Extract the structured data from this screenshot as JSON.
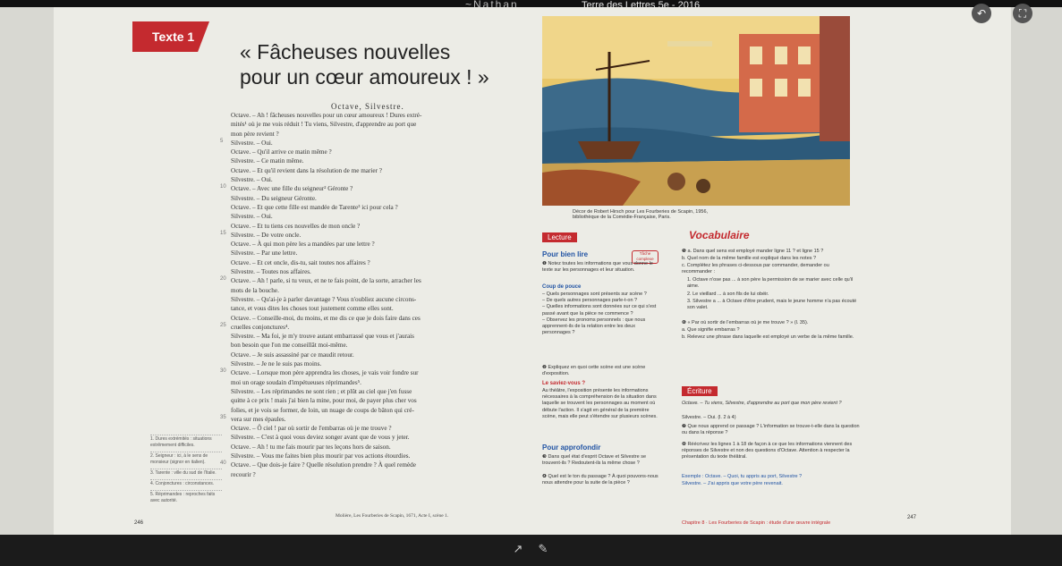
{
  "app": {
    "title": "Terre des Lettres 5e - 2016",
    "logo": "~Nathan"
  },
  "toolbar": {
    "undo_icon": "undo-icon",
    "fullscreen_icon": "fullscreen-icon"
  },
  "page": {
    "tab_label": "Texte 1",
    "heading_line1": "« Fâcheuses nouvelles",
    "heading_line2": "pour un cœur amoureux ! »",
    "speakers": "Octave, Silvestre.",
    "dialogue": [
      "Octave. – Ah ! fâcheuses nouvelles pour un cœur amoureux ! Dures extré-",
      "mités¹ où je me vois réduit ! Tu viens, Silvestre, d'apprendre au port que",
      "mon père revient ?",
      "Silvestre. – Oui.",
      "Octave. – Qu'il arrive ce matin même ?",
      "Silvestre. – Ce matin même.",
      "Octave. – Et qu'il revient dans la résolution de me marier ?",
      "Silvestre. – Oui.",
      "Octave. – Avec une fille du seigneur² Géronte ?",
      "Silvestre. – Du seigneur Géronte.",
      "Octave. – Et que cette fille est mandée de Tarente³ ici pour cela ?",
      "Silvestre. – Oui.",
      "Octave. – Et tu tiens ces nouvelles de mon oncle ?",
      "Silvestre. – De votre oncle.",
      "Octave. – À qui mon père les a mandées par une lettre ?",
      "Silvestre. – Par une lettre.",
      "Octave. – Et cet oncle, dis-tu, sait toutes nos affaires ?",
      "Silvestre. – Toutes nos affaires.",
      "Octave. – Ah ! parle, si tu veux, et ne te fais point, de la sorte, arracher les",
      "mots de la bouche.",
      "Silvestre. – Qu'ai-je à parler davantage ? Vous n'oubliez aucune circons-",
      "tance, et vous dites les choses tout justement comme elles sont.",
      "Octave. – Conseille-moi, du moins, et me dis ce que je dois faire dans ces",
      "cruelles conjonctures⁴.",
      "Silvestre. – Ma foi, je m'y trouve autant embarrassé que vous et j'aurais",
      "bon besoin que l'on me conseillât moi-même.",
      "Octave. – Je suis assassiné par ce maudit retour.",
      "Silvestre. – Je ne le suis pas moins.",
      "Octave. – Lorsque mon père apprendra les choses, je vais voir fondre sur",
      "moi un orage soudain d'impétueuses réprimandes⁵.",
      "Silvestre. – Les réprimandes ne sont rien ; et plût au ciel que j'en fusse",
      "quitte à ce prix ! mais j'ai bien la mine, pour moi, de payer plus cher vos",
      "folies, et je vois se former, de loin, un nuage de coups de bâton qui cré-",
      "vera sur mes épaules.",
      "Octave. – Ô ciel ! par où sortir de l'embarras où je me trouve ?",
      "Silvestre. – C'est à quoi vous deviez songer avant que de vous y jeter.",
      "Octave. – Ah ! tu me fais mourir par tes leçons hors de saison.",
      "Silvestre. – Vous me faites bien plus mourir par vos actions étourdies.",
      "Octave. – Que dois-je faire ? Quelle résolution prendre ? À quel remède",
      "recourir ?"
    ],
    "line_numbers": [
      "5",
      "10",
      "15",
      "20",
      "25",
      "30",
      "35",
      "40"
    ],
    "notes": [
      "1. Dures extrémités : situations extrêmement difficiles.",
      "2. Seigneur : ici, à le sens de monsieur (signor en italien).",
      "3. Tarente : ville du sud de l'Italie.",
      "4. Conjonctures : circonstances.",
      "5. Réprimandes : reproches faits avec autorité."
    ],
    "credit": "Molière, Les Fourberies de Scapin, 1671, Acte I, scène 1.",
    "page_left": "246",
    "page_right": "247",
    "caption_line1": "Décor de Robert Hirsch pour Les Fourberies de Scapin, 1956,",
    "caption_line2": "bibliothèque de la Comédie-Française, Paris."
  },
  "lecture": {
    "badge": "Lecture",
    "pour_bien_lire": "Pour bien lire",
    "tache": "Tâche complexe",
    "q1": "❶ Notez toutes les informations que vous donne le texte sur les personnages et leur situation.",
    "coup_de_pouce": "Coup de pouce",
    "coup_items": [
      "– Quels personnages sont présents sur scène ?",
      "– De quels autres personnages parle-t-on ?",
      "– Quelles informations sont données sur ce qui s'est passé avant que la pièce ne commence ?",
      "– Observez les pronoms personnels : que nous apprennent-ils de la relation entre les deux personnages ?"
    ],
    "q2": "❷ Expliquez en quoi cette scène est une scène d'exposition.",
    "le_saviez": "Le saviez-vous ?",
    "saviez_text": "Au théâtre, l'exposition présente les informations nécessaires à la compréhension de la situation dans laquelle se trouvent les personnages au moment où débute l'action. Il s'agit en général de la première scène, mais elle peut s'étendre sur plusieurs scènes.",
    "approfondir": "Pour approfondir",
    "q3": "❸ Dans quel état d'esprit Octave et Silvestre se trouvent-ils ? Redoutent-ils la même chose ?",
    "q4": "❹ Quel est le ton du passage ? À quoi pouvons-nous nous attendre pour la suite de la pièce ?"
  },
  "vocabulaire": {
    "title": "Vocabulaire",
    "q5": "❺ a. Dans quel sens est employé mander ligne 11 ? et ligne 15 ?",
    "q5b": "b. Quel nom de la même famille est expliqué dans les notes ?",
    "q5c": "c. Complétez les phrases ci-dessous par commander, demander ou recommander :",
    "q5c1": "1. Octave n'ose pas ... à son père la permission de se marier avec celle qu'il aime.",
    "q5c2": "2. Le vieillard ... à son fils de lui obéir.",
    "q5c3": "3. Silvestre a ... à Octave d'être prudent, mais le jeune homme n'a pas écouté son valet.",
    "q6": "❻ « Par où sortir de l'embarras où je me trouve ? » (l. 35).",
    "q6a": "a. Que signifie embarras ?",
    "q6b": "b. Relevez une phrase dans laquelle est employé un verbe de la même famille.",
    "ecriture_badge": "Écriture",
    "ecriture_quote": "Octave. – Tu viens, Silvestre, d'apprendre au port que mon père revient ?",
    "ecriture_ref": "Silvestre. – Oui. (l. 2 à 4)",
    "q7": "❼ Que nous apprend ce passage ? L'information se trouve-t-elle dans la question ou dans la réponse ?",
    "q8": "❽ Réécrivez les lignes 1 à 18 de façon à ce que les informations viennent des réponses de Silvestre et non des questions d'Octave. Attention à respecter la présentation du texte théâtral.",
    "exemple": "Exemple : Octave. – Quoi, tu appris au port, Silvestre ?",
    "exemple2": "Silvestre. – J'ai appris que votre père revenait.",
    "footer": "Chapitre 8 · Les Fourberies de Scapin : étude d'une œuvre intégrale"
  },
  "bottombar": {
    "tools": [
      "arrow-icon",
      "pen-icon"
    ]
  }
}
